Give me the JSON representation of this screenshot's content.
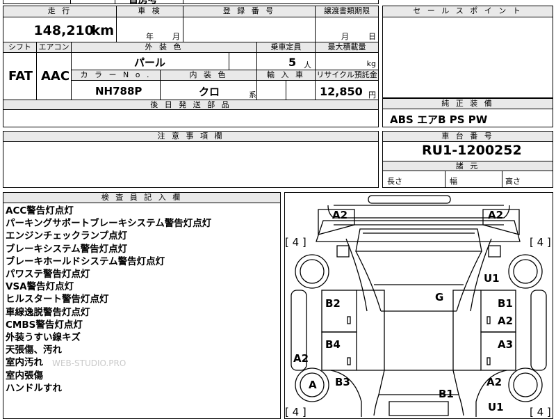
{
  "top_fragment": "首房考",
  "vehicle": {
    "mileage_header": "走 行",
    "mileage_value": "148,210",
    "mileage_unit": "km",
    "inspection_header": "車 検",
    "inspection_year": "年",
    "inspection_month": "月",
    "registration_header": "登 録 番 号",
    "transfer_header": "譲渡書類期限",
    "transfer_month": "月",
    "transfer_day": "日",
    "shift_header": "シフト",
    "shift_value": "FAT",
    "aircon_header": "エアコン",
    "aircon_value": "AAC",
    "exterior_header": "外 装 色",
    "exterior_value": "パール",
    "capacity_header": "乗車定員",
    "capacity_value": "5",
    "capacity_unit": "人",
    "maxload_header": "最大積載量",
    "maxload_unit": "kg",
    "color_no_header": "カ ラ ー N o .",
    "color_no_value": "NH788P",
    "interior_header": "内 装 色",
    "interior_value": "クロ",
    "interior_suffix": "系",
    "import_header": "輸 入 車",
    "recycle_header": "リサイクル預託金",
    "recycle_value": "12,850",
    "recycle_unit": "円",
    "later_parts_header": "後 日 発 送 部 品"
  },
  "sales_point": {
    "header": "セ ー ル ス ポ イ ン ト"
  },
  "equipment": {
    "header": "純 正 装 備",
    "value": "ABS エアB PS PW"
  },
  "caution": {
    "header": "注 意 事 項 欄"
  },
  "chassis": {
    "header": "車 台 番 号",
    "value": "RU1-1200252",
    "dims_header": "諸 元",
    "length_label": "長さ",
    "width_label": "幅",
    "height_label": "高さ"
  },
  "inspector": {
    "header": "検 査 員 記 入 欄",
    "notes": [
      "ACC警告灯点灯",
      "パーキングサポートブレーキシステム警告灯点灯",
      "エンジンチェックランプ点灯",
      "ブレーキシステム警告灯点灯",
      "ブレーキホールドシステム警告灯点灯",
      "パワステ警告灯点灯",
      "VSA警告灯点灯",
      "ヒルスタート警告灯点灯",
      "車線逸脱警告灯点灯",
      "CMBS警告灯点灯",
      "外装うすい線キズ",
      "天張傷、汚れ",
      "室内汚れ",
      "室内張傷",
      "ハンドルすれ"
    ],
    "watermark": "WEB-STUDIO.PRO"
  },
  "diagram": {
    "marks": {
      "front_left": "A2",
      "front_right": "A2",
      "tire_fl": "[ 4 ]",
      "tire_fr": "[ 4 ]",
      "tire_rl": "[ 4 ]",
      "tire_rr": "[ 4 ]",
      "fender_right": "U1",
      "roof": "G",
      "door_left_front": "B2",
      "door_right_front_1": "B1",
      "door_right_front_2": "A2",
      "door_left_rear": "B4",
      "door_right_rear": "A3",
      "sill_left": "A2",
      "wheel_rear_left": "A",
      "quarter_left": "B3",
      "quarter_right": "A2",
      "rear_center": "B1",
      "rear_right": "U1"
    }
  }
}
